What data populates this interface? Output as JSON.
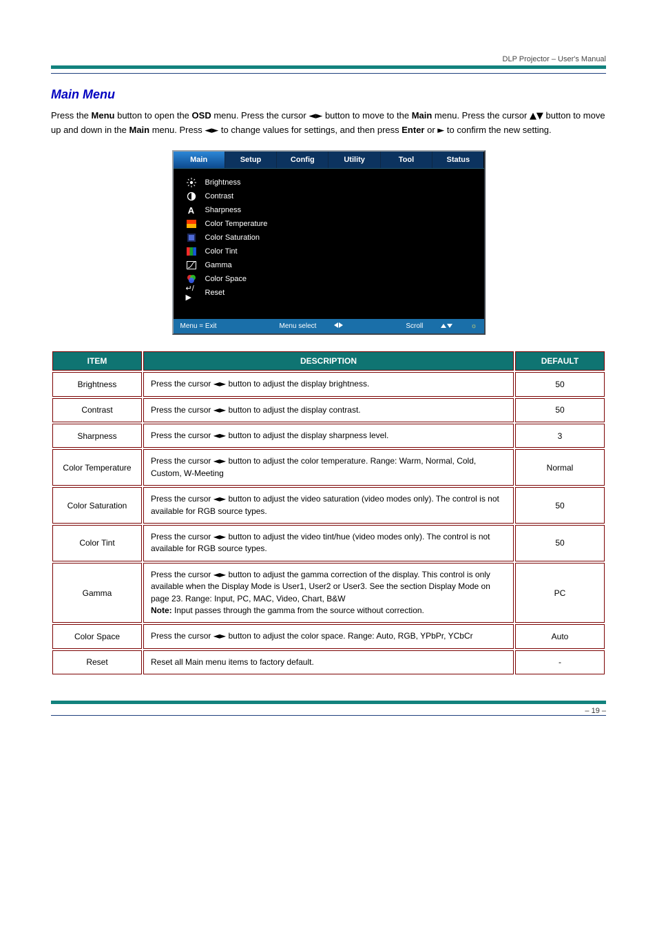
{
  "header": {
    "title": "DLP Projector – User's Manual"
  },
  "heading": "Main Menu",
  "intro": {
    "p1a": "Press the ",
    "p1b": "Menu",
    "p1c": " button to open the ",
    "p1d": "OSD",
    "p1e": " menu. Press the cursor ",
    "p1f": " button to move to the ",
    "p1g": "Main",
    "p1h": " menu. Press the cursor ",
    "p1i": " button to move up and down in the ",
    "p1j": "Main",
    "p1k": " menu. Press ",
    "p1l": " to change values for settings, and then press ",
    "p1m": "Enter",
    "p1n": " or ",
    "p1o": " to confirm the new setting."
  },
  "osd": {
    "tabs": [
      "Main",
      "Setup",
      "Config",
      "Utility",
      "Tool",
      "Status"
    ],
    "items": [
      {
        "label": "Brightness"
      },
      {
        "label": "Contrast"
      },
      {
        "label": "Sharpness"
      },
      {
        "label": "Color Temperature"
      },
      {
        "label": "Color Saturation"
      },
      {
        "label": "Color Tint"
      },
      {
        "label": "Gamma"
      },
      {
        "label": "Color Space"
      },
      {
        "label": "Reset"
      }
    ],
    "footer": {
      "exit": "Menu = Exit",
      "select": "Menu select",
      "scroll": "Scroll"
    }
  },
  "table": {
    "headers": {
      "item": "ITEM",
      "desc": "DESCRIPTION",
      "def": "DEFAULT"
    },
    "rows": [
      {
        "item": "Brightness",
        "desc_pre": "Press the cursor ",
        "desc_post": " button to adjust the display brightness.",
        "def": "50"
      },
      {
        "item": "Contrast",
        "desc_pre": "Press the cursor ",
        "desc_post": " button to adjust the display contrast.",
        "def": "50"
      },
      {
        "item": "Sharpness",
        "desc_pre": "Press the cursor ",
        "desc_post": " button to adjust the display sharpness level.",
        "def": "3"
      },
      {
        "item": "Color Temperature",
        "desc_pre": "Press the cursor ",
        "desc_post": " button to adjust the color temperature. Range: Warm, Normal, Cold, Custom, W-Meeting",
        "def": "Normal"
      },
      {
        "item": "Color Saturation",
        "desc_pre": "Press the cursor ",
        "desc_post": " button to adjust the video saturation (video modes only). The control is not available for RGB source types.",
        "def": "50"
      },
      {
        "item": "Color Tint",
        "desc_pre": "Press the cursor ",
        "desc_post": " button to adjust the video tint/hue (video modes only). The control is not available for RGB source types.",
        "def": "50"
      },
      {
        "item": "Gamma",
        "desc_pre": "Press the cursor ",
        "desc_post": " button to adjust the gamma correction of the display. This control is only available when the Display Mode is User1, User2 or User3. See the section Display Mode on page 23. Range: Input, PC, MAC, Video, Chart, B&W",
        "desc_note_label": "Note:",
        "desc_note": "Input passes through the gamma from the source without correction.",
        "def": "PC"
      },
      {
        "item": "Color Space",
        "desc_pre": "Press the cursor ",
        "desc_post": " button to adjust the color space. Range: Auto, RGB, YPbPr, YCbCr",
        "def": "Auto"
      },
      {
        "item": "Reset",
        "desc_pre": "",
        "desc_post": "Reset all Main menu items to factory default.",
        "def": "-"
      }
    ]
  },
  "footer": {
    "left": "",
    "right": "– 19 –"
  }
}
